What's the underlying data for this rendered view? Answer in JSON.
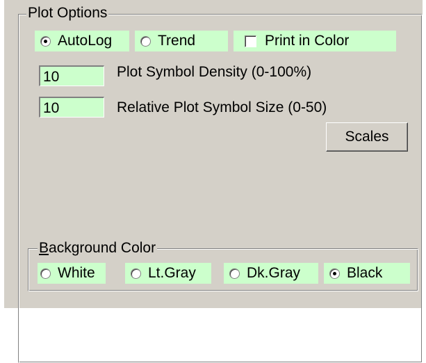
{
  "plot_options": {
    "title": "Plot Options",
    "mode_radios": [
      {
        "label": "AutoLog",
        "checked": true
      },
      {
        "label": "Trend",
        "checked": false
      }
    ],
    "print_in_color": {
      "label": "Print in Color",
      "checked": false
    },
    "density": {
      "value": "10",
      "label": "Plot Symbol Density (0-100%)"
    },
    "symbol_size": {
      "value": "10",
      "label": "Relative Plot Symbol Size (0-50)"
    },
    "scales_button": "Scales"
  },
  "background_color": {
    "title_first": "B",
    "title_rest": "ackground Color",
    "options": [
      {
        "label": "White",
        "checked": false
      },
      {
        "label": "Lt.Gray",
        "checked": false
      },
      {
        "label": "Dk.Gray",
        "checked": false
      },
      {
        "label": "Black",
        "checked": true
      }
    ]
  },
  "colors": {
    "field_bg": "#ccffcc",
    "panel_bg": "#d4d0c8"
  }
}
